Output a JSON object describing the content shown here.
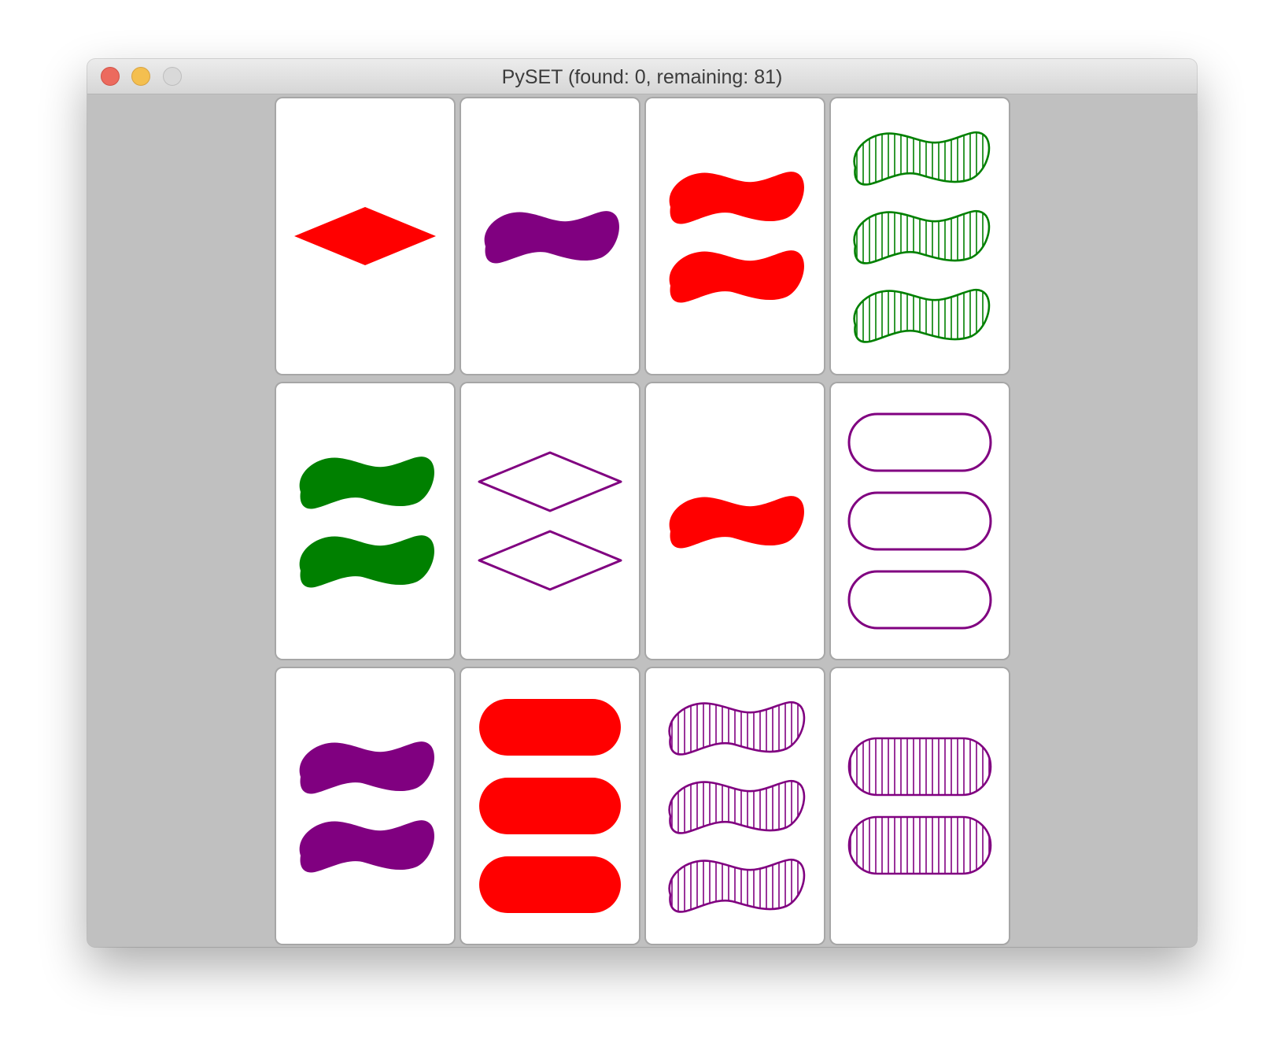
{
  "window": {
    "title": "PySET (found: 0, remaining: 81)",
    "found": 0,
    "remaining": 81
  },
  "colors": {
    "red": "#ff0000",
    "green": "#008000",
    "purple": "#800080"
  },
  "cards": [
    {
      "count": 1,
      "shape": "diamond",
      "color": "red",
      "fill": "solid"
    },
    {
      "count": 1,
      "shape": "squiggle",
      "color": "purple",
      "fill": "solid"
    },
    {
      "count": 2,
      "shape": "squiggle",
      "color": "red",
      "fill": "solid"
    },
    {
      "count": 3,
      "shape": "squiggle",
      "color": "green",
      "fill": "striped"
    },
    {
      "count": 2,
      "shape": "squiggle",
      "color": "green",
      "fill": "solid"
    },
    {
      "count": 2,
      "shape": "diamond",
      "color": "purple",
      "fill": "open"
    },
    {
      "count": 1,
      "shape": "squiggle",
      "color": "red",
      "fill": "solid"
    },
    {
      "count": 3,
      "shape": "oval",
      "color": "purple",
      "fill": "open"
    },
    {
      "count": 2,
      "shape": "squiggle",
      "color": "purple",
      "fill": "solid"
    },
    {
      "count": 3,
      "shape": "oval",
      "color": "red",
      "fill": "solid"
    },
    {
      "count": 3,
      "shape": "squiggle",
      "color": "purple",
      "fill": "striped"
    },
    {
      "count": 2,
      "shape": "oval",
      "color": "purple",
      "fill": "striped"
    }
  ]
}
